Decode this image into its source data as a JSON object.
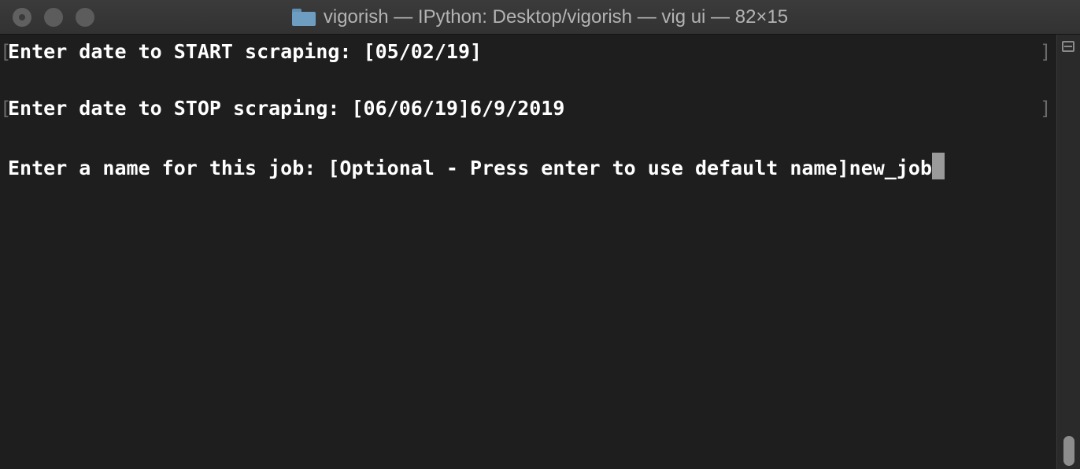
{
  "window": {
    "title": "vigorish — IPython: Desktop/vigorish — vig ui — 82×15",
    "icon": "folder-icon",
    "buttons": [
      "close",
      "minimize",
      "zoom"
    ]
  },
  "terminal": {
    "lines": [
      "Enter date to START scraping: [05/02/19]",
      "Enter date to STOP scraping: [06/06/19]6/9/2019",
      "Enter a name for this job: [Optional - Press enter to use default name]new_job"
    ],
    "mark_open": "[",
    "mark_close": "]"
  },
  "colors": {
    "background": "#1e1e1e",
    "text": "#ffffff",
    "cursor": "#9a9a9a",
    "titlebar": "#353535",
    "folder": "#6d9dc0"
  }
}
